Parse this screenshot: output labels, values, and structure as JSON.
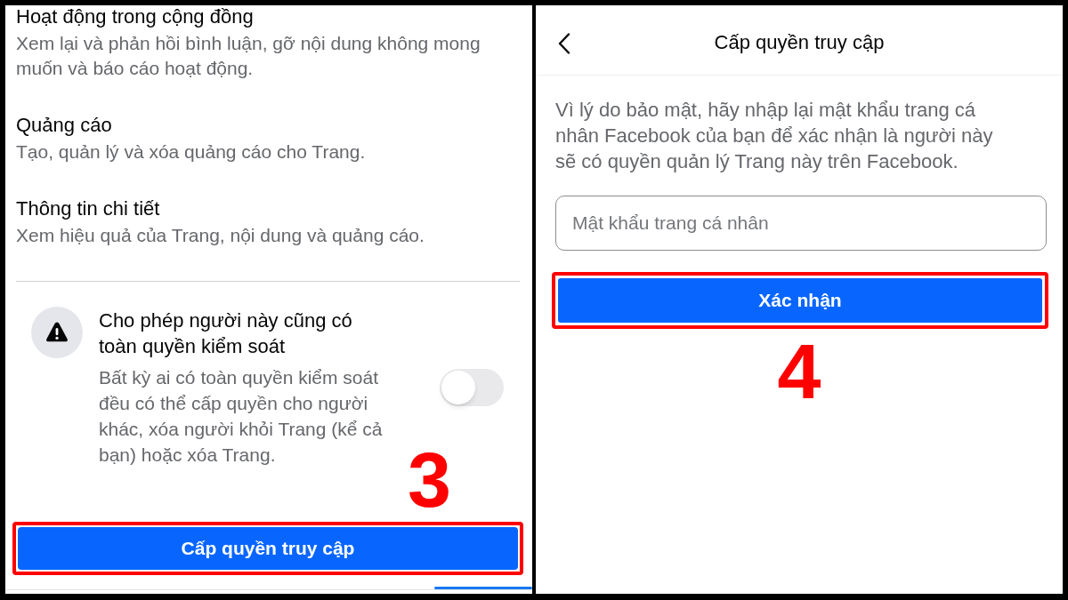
{
  "left_screen": {
    "settings": [
      {
        "title": "Hoạt động trong cộng đồng",
        "description": "Xem lại và phản hồi bình luận, gỡ nội dung không mong muốn và báo cáo hoạt động."
      },
      {
        "title": "Quảng cáo",
        "description": "Tạo, quản lý và xóa quảng cáo cho Trang."
      },
      {
        "title": "Thông tin chi tiết",
        "description": "Xem hiệu quả của Trang, nội dung và quảng cáo."
      }
    ],
    "full_control": {
      "title": "Cho phép người này cũng có toàn quyền kiểm soát",
      "description": "Bất kỳ ai có toàn quyền kiểm soát đều có thể cấp quyền cho người khác, xóa người khỏi Trang (kể cả bạn) hoặc xóa Trang.",
      "on": false
    },
    "button": {
      "label": "Cấp quyền truy cập",
      "highlighted": true
    },
    "step_label": "3"
  },
  "right_screen": {
    "header": {
      "title": "Cấp quyền truy cập"
    },
    "message": "Vì lý do bảo mật, hãy nhập lại mật khẩu trang cá nhân Facebook của bạn để xác nhận là người này sẽ có quyền quản lý Trang này trên Facebook.",
    "password_field": {
      "placeholder": "Mật khẩu trang cá nhân"
    },
    "button": {
      "label": "Xác nhận",
      "highlighted": true
    },
    "step_label": "4"
  }
}
